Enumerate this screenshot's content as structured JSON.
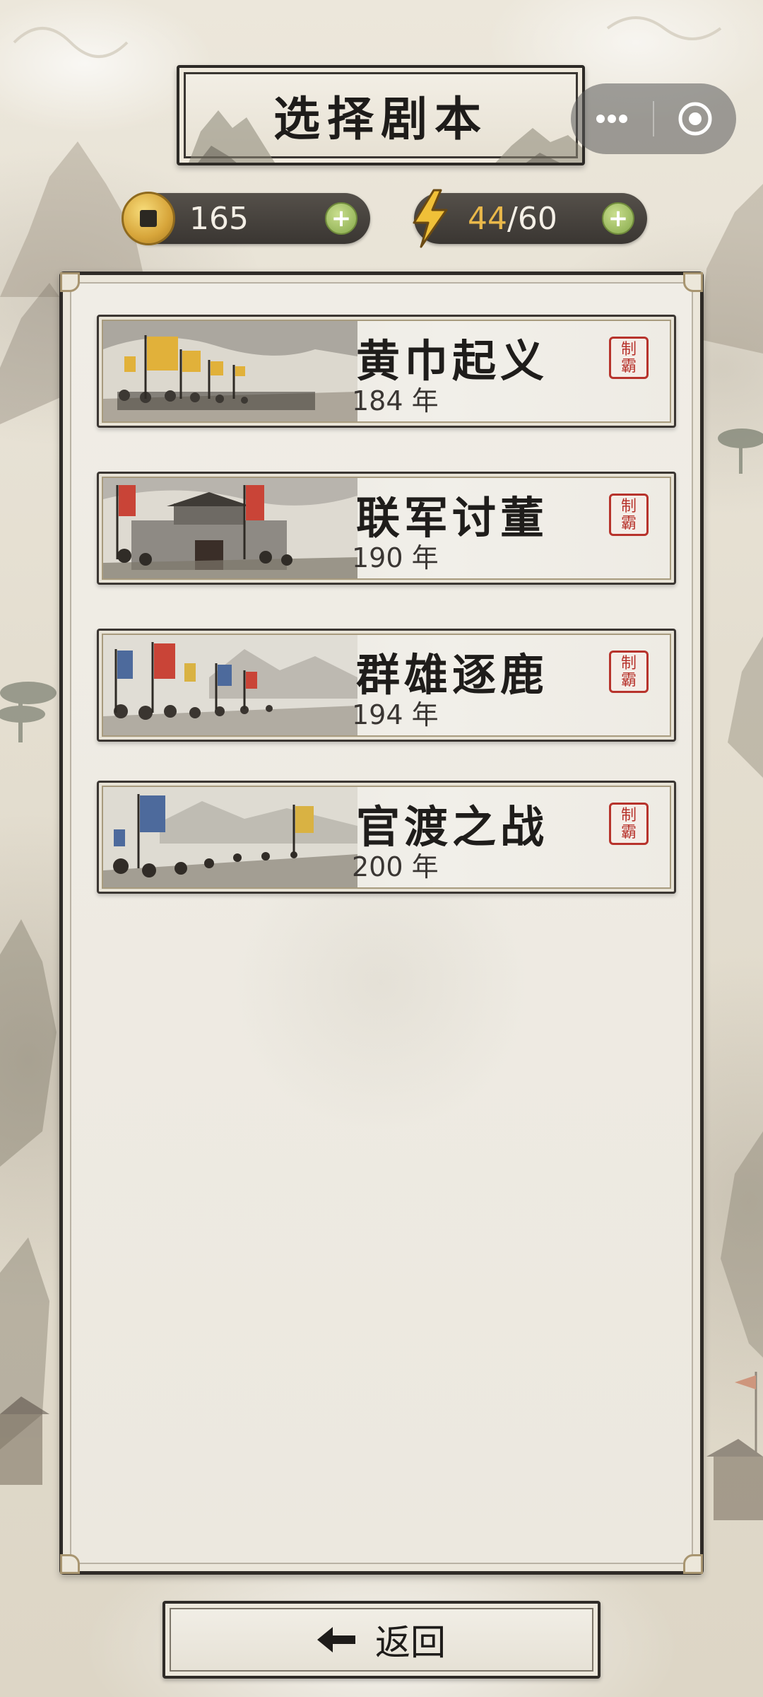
{
  "header": {
    "title": "选择剧本"
  },
  "resources": {
    "coins": "165",
    "energy_current": "44",
    "energy_separator": "/",
    "energy_max": "60"
  },
  "scenarios": [
    {
      "name": "黄巾起义",
      "year": "184 年",
      "seal": "制霸"
    },
    {
      "name": "联军讨董",
      "year": "190 年",
      "seal": "制霸"
    },
    {
      "name": "群雄逐鹿",
      "year": "194 年",
      "seal": "制霸"
    },
    {
      "name": "官渡之战",
      "year": "200 年",
      "seal": "制霸"
    }
  ],
  "footer": {
    "back_label": "返回"
  },
  "icons": {
    "coin": "coin-icon",
    "energy": "lightning-icon",
    "add": "plus-icon",
    "more": "more-icon",
    "close": "target-icon",
    "back": "arrow-left-icon"
  },
  "colors": {
    "accent_gold": "#e9b84a",
    "seal_red": "#b7332c",
    "plus_green": "#86a94a"
  }
}
